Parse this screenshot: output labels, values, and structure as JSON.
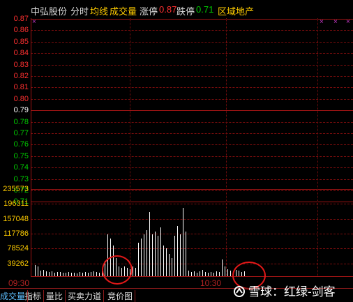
{
  "header": {
    "stock_name": "中弘股份",
    "mode": "分时",
    "avg_line": "均线",
    "volume": "成交量",
    "limit_up_label": "涨停",
    "limit_up_value": "0.87",
    "limit_down_label": "跌停",
    "limit_down_value": "0.71",
    "sector": "区域地产"
  },
  "price_axis": [
    "0.87",
    "0.86",
    "0.85",
    "0.84",
    "0.83",
    "0.82",
    "0.81",
    "0.80",
    "0.79",
    "0.78",
    "0.77",
    "0.76",
    "0.75",
    "0.74",
    "0.73",
    "0.72",
    "0.71"
  ],
  "volume_axis": [
    "235573",
    "196311",
    "157048",
    "117786",
    "78524",
    "39262"
  ],
  "time_labels": {
    "start": "09:30",
    "mid": "10:30"
  },
  "tabs": [
    "成交量",
    "指标",
    "量比",
    "买卖力道",
    "竞价图"
  ],
  "watermark": "雪球：红绿-剑客",
  "colors": {
    "up": "#ff3030",
    "flat": "#ffffff",
    "down": "#00cc00",
    "accent": "#ffcc00"
  },
  "volume_bars": [
    16,
    14,
    8,
    9,
    7,
    6,
    7,
    5,
    6,
    6,
    5,
    5,
    6,
    5,
    5,
    4,
    6,
    5,
    6,
    5,
    6,
    7,
    6,
    5,
    7,
    22,
    60,
    54,
    44,
    26,
    14,
    12,
    14,
    12,
    10,
    14,
    12,
    48,
    54,
    60,
    66,
    92,
    60,
    64,
    58,
    70,
    44,
    40,
    32,
    26,
    58,
    72,
    60,
    98,
    64,
    8,
    6,
    7,
    5,
    7,
    9,
    6,
    5,
    6,
    5,
    7,
    6,
    24,
    14,
    10,
    8,
    7,
    9,
    8,
    6,
    7
  ]
}
